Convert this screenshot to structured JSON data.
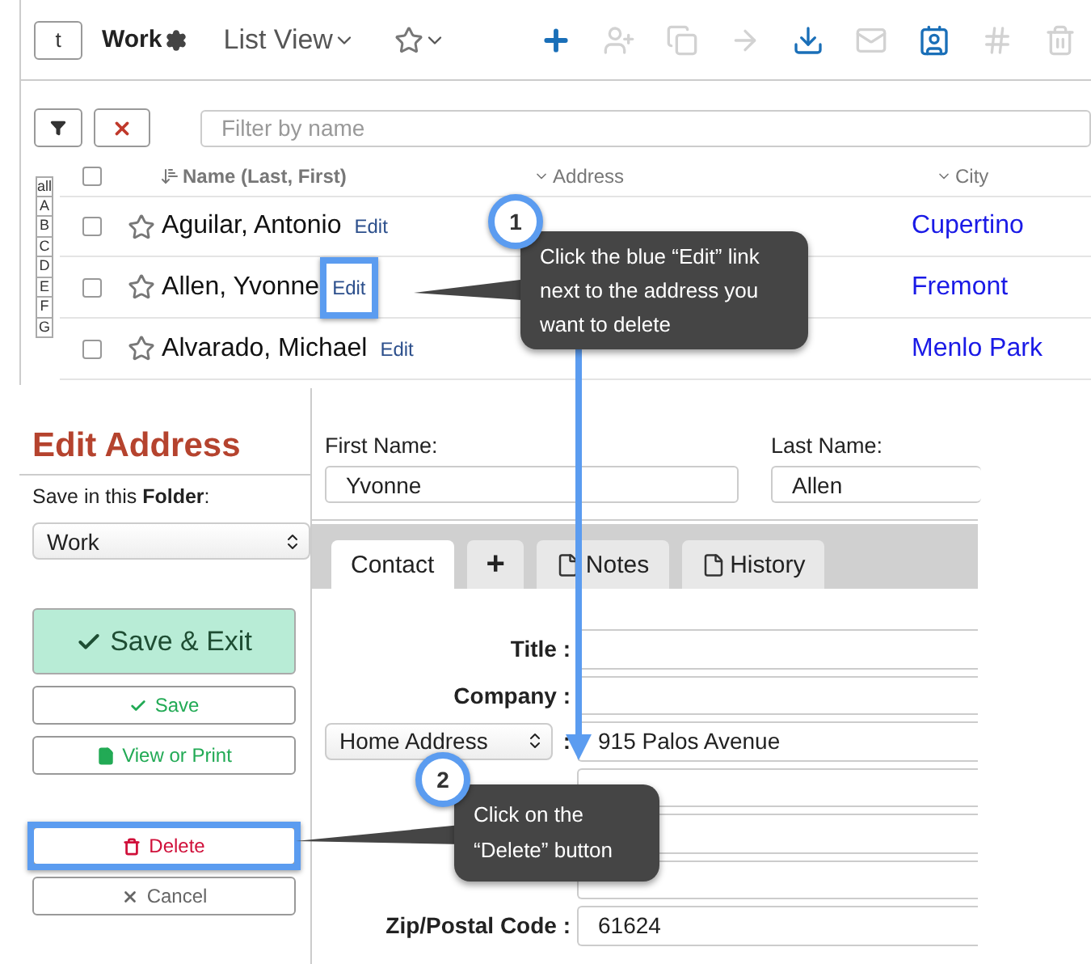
{
  "toolbar": {
    "back_button": "t",
    "folder": "Work",
    "view": "List View",
    "actions": [
      {
        "kind": "add",
        "disabled": false
      },
      {
        "kind": "add-user",
        "disabled": true
      },
      {
        "kind": "copy",
        "disabled": true
      },
      {
        "kind": "move",
        "disabled": true
      },
      {
        "kind": "download",
        "disabled": false
      },
      {
        "kind": "mail",
        "disabled": true
      },
      {
        "kind": "card",
        "disabled": false
      },
      {
        "kind": "hash",
        "disabled": true
      },
      {
        "kind": "trash",
        "disabled": true
      }
    ]
  },
  "filter": {
    "placeholder": "Filter by name"
  },
  "alphabet": [
    "all",
    "A",
    "B",
    "C",
    "D",
    "E",
    "F",
    "G"
  ],
  "columns": [
    "Name (Last, First)",
    "Address",
    "City"
  ],
  "header_checked": false,
  "contacts": [
    {
      "name": "Aguilar, Antonio",
      "edit": "Edit",
      "city": "Cupertino",
      "checked": false,
      "starred": false,
      "highlighted": false
    },
    {
      "name": "Allen, Yvonne",
      "edit": "Edit",
      "city": "Fremont",
      "checked": false,
      "starred": false,
      "highlighted": true
    },
    {
      "name": "Alvarado, Michael",
      "edit": "Edit",
      "city": "Menlo Park",
      "checked": false,
      "starred": false,
      "highlighted": false
    }
  ],
  "editor": {
    "title": "Edit Address",
    "folder_label": "Save in this **Folder**:",
    "folder": "Work",
    "buttons": [
      {
        "kind": "primary",
        "label": "Save & Exit",
        "highlighted": false
      },
      {
        "kind": "save",
        "label": "Save",
        "highlighted": false
      },
      {
        "kind": "print",
        "label": "View or Print",
        "highlighted": false
      },
      {
        "kind": "delete",
        "label": "Delete",
        "highlighted": true
      },
      {
        "kind": "cancel",
        "label": "Cancel",
        "highlighted": false
      }
    ],
    "first_name_label": "First Name:",
    "first_name": "Yvonne",
    "last_name_label": "Last Name:",
    "last_name": "Allen",
    "tabs": [
      {
        "label": "Contact",
        "kind": "plain",
        "selected": true
      },
      {
        "label": "+",
        "kind": "plain",
        "selected": false
      },
      {
        "label": "Notes",
        "kind": "doc",
        "selected": false
      },
      {
        "label": "History",
        "kind": "doc",
        "selected": false
      }
    ],
    "fields": [
      {
        "kind": "text",
        "label": "Title :"
      },
      {
        "kind": "text",
        "label": "Company :"
      },
      {
        "kind": "select",
        "label": "Home Address",
        "separator": ":",
        "value": "915 Palos Avenue"
      },
      {
        "kind": "text"
      },
      {
        "kind": "text"
      },
      {
        "kind": "text"
      },
      {
        "kind": "text",
        "label": "Zip/Postal Code :",
        "value": "61624"
      }
    ]
  },
  "callouts": [
    {
      "number": "1",
      "text": "Click the blue “Edit” link next to the address you want to delete"
    },
    {
      "number": "2",
      "text": "Click on the “Delete” button"
    }
  ]
}
